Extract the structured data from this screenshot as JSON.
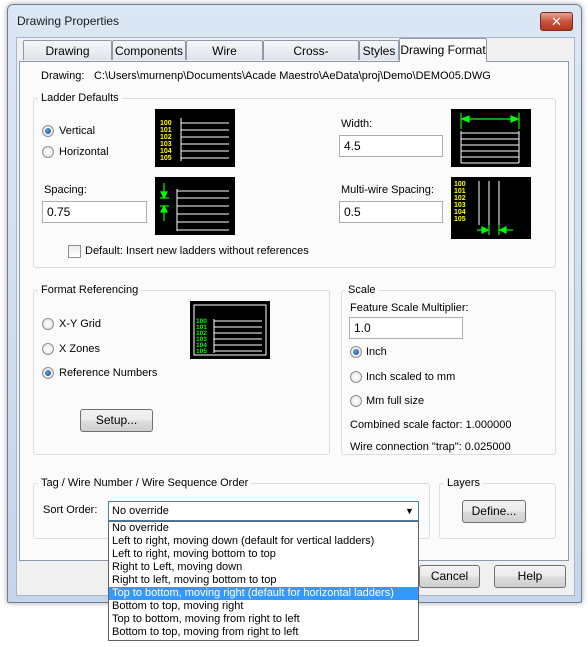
{
  "window": {
    "title": "Drawing Properties",
    "close_glyph": "✕"
  },
  "tabs": [
    {
      "label": "Drawing Settings"
    },
    {
      "label": "Components"
    },
    {
      "label": "Wire Numbers"
    },
    {
      "label": "Cross-References"
    },
    {
      "label": "Styles"
    },
    {
      "label": "Drawing Format",
      "active": true
    }
  ],
  "drawing": {
    "label": "Drawing:",
    "path": "C:\\Users\\murnenp\\Documents\\Acade Maestro\\AeData\\proj\\Demo\\DEMO05.DWG"
  },
  "ladder": {
    "legend": "Ladder Defaults",
    "vertical": "Vertical",
    "horizontal": "Horizontal",
    "selected": "vertical",
    "spacing_label": "Spacing:",
    "spacing_value": "0.75",
    "width_label": "Width:",
    "width_value": "4.5",
    "multiwire_label": "Multi-wire Spacing:",
    "multiwire_value": "0.5",
    "default_checkbox": "Default: Insert new ladders without references",
    "default_checked": false,
    "preview_numbers": [
      "100",
      "101",
      "102",
      "103",
      "104",
      "105"
    ]
  },
  "format_ref": {
    "legend": "Format Referencing",
    "xy_grid": "X-Y Grid",
    "x_zones": "X Zones",
    "ref_numbers": "Reference Numbers",
    "selected": "ref_numbers",
    "setup_button": "Setup...",
    "preview_numbers": [
      "100",
      "101",
      "102",
      "103",
      "104",
      "105"
    ]
  },
  "scale": {
    "legend": "Scale",
    "multiplier_label": "Feature Scale Multiplier:",
    "multiplier_value": "1.0",
    "inch": "Inch",
    "inch_scaled": "Inch scaled to mm",
    "mm_full": "Mm full size",
    "selected": "inch",
    "combined": "Combined scale factor: 1.000000",
    "trap": "Wire connection \"trap\": 0.025000"
  },
  "sequence": {
    "legend": "Tag / Wire Number / Wire Sequence Order",
    "sort_label": "Sort Order:",
    "current": "No override",
    "options": [
      "No override",
      "Left to right, moving down (default for vertical ladders)",
      "Left to right, moving bottom to top",
      "Right to Left, moving down",
      "Right to left, moving bottom to top",
      "Top to bottom, moving right (default for horizontal ladders)",
      "Bottom to top, moving right",
      "Top to bottom, moving from right to left",
      "Bottom to top, moving from right to left"
    ],
    "highlighted_index": 5
  },
  "layers": {
    "legend": "Layers",
    "define_button": "Define..."
  },
  "footer": {
    "cancel": "Cancel",
    "help": "Help"
  },
  "colors": {
    "preview_bg": "#000000",
    "preview_numbers": "#ffff00",
    "preview_numbers_green": "#00ff00",
    "preview_arrow": "#00ff00",
    "selection": "#3399ff"
  }
}
